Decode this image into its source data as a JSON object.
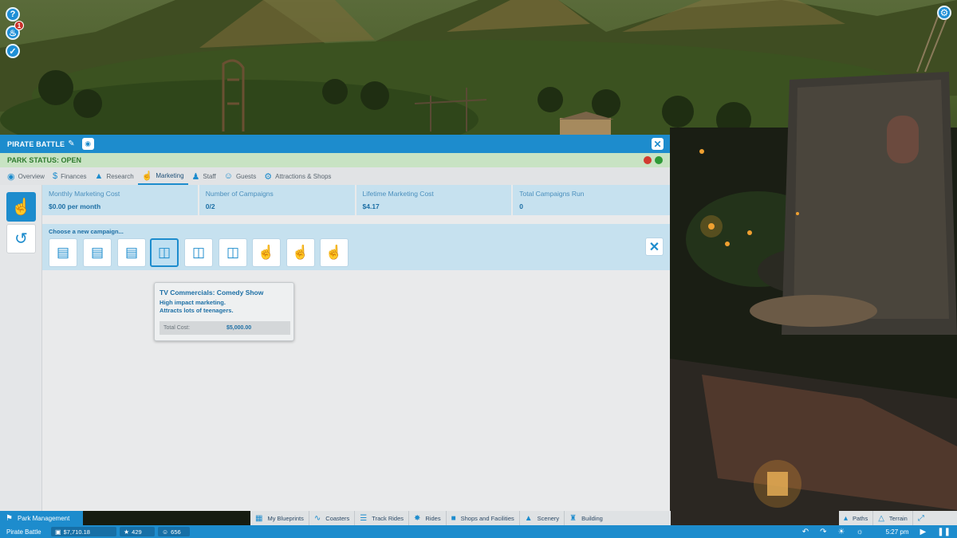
{
  "hud": {
    "help_icon": "question-icon",
    "notification_count": "1",
    "checklist_icon": "check-icon",
    "settings_icon": "gear-icon"
  },
  "panel": {
    "title": "PIRATE BATTLE",
    "status": "PARK STATUS: OPEN",
    "tabs": [
      {
        "label": "Overview",
        "icon": "eye-icon"
      },
      {
        "label": "Finances",
        "icon": "dollar-icon"
      },
      {
        "label": "Research",
        "icon": "flask-icon"
      },
      {
        "label": "Marketing",
        "icon": "thumbs-up-icon"
      },
      {
        "label": "Staff",
        "icon": "staff-icon"
      },
      {
        "label": "Guests",
        "icon": "guests-icon"
      },
      {
        "label": "Attractions & Shops",
        "icon": "gear-icon"
      }
    ],
    "stats": [
      {
        "label": "Monthly Marketing Cost",
        "value": "$0.00 per month"
      },
      {
        "label": "Number of Campaigns",
        "value": "0/2"
      },
      {
        "label": "Lifetime Marketing Cost",
        "value": "$4.17"
      },
      {
        "label": "Total Campaigns Run",
        "value": "0"
      }
    ],
    "chooser_prompt": "Choose a new campaign...",
    "campaigns": [
      "newspaper-icon",
      "newspaper-icon",
      "newspaper-icon",
      "tv-icon",
      "tv-icon",
      "tv-icon",
      "phone-thumb-icon",
      "phone-thumb-icon",
      "phone-thumb-icon"
    ],
    "tooltip": {
      "title": "TV Commercials: Comedy Show",
      "line1": "High impact marketing.",
      "line2": "Attracts lots of teenagers.",
      "cost_label": "Total Cost:",
      "cost_value": "$5,000.00"
    }
  },
  "bottom": {
    "park_management": "Park Management",
    "build_tabs": [
      "My Blueprints",
      "Coasters",
      "Track Rides",
      "Rides",
      "Shops and Facilities",
      "Scenery",
      "Building"
    ],
    "right_tabs": [
      "Paths",
      "Terrain"
    ],
    "park_name": "Pirate Battle",
    "money": "$7,710.18",
    "rating": "429",
    "guests": "656",
    "time": "5:27 pm"
  },
  "colors": {
    "accent": "#1d8ccd",
    "status_green": "#2e9a37",
    "status_red": "#d23b30"
  }
}
